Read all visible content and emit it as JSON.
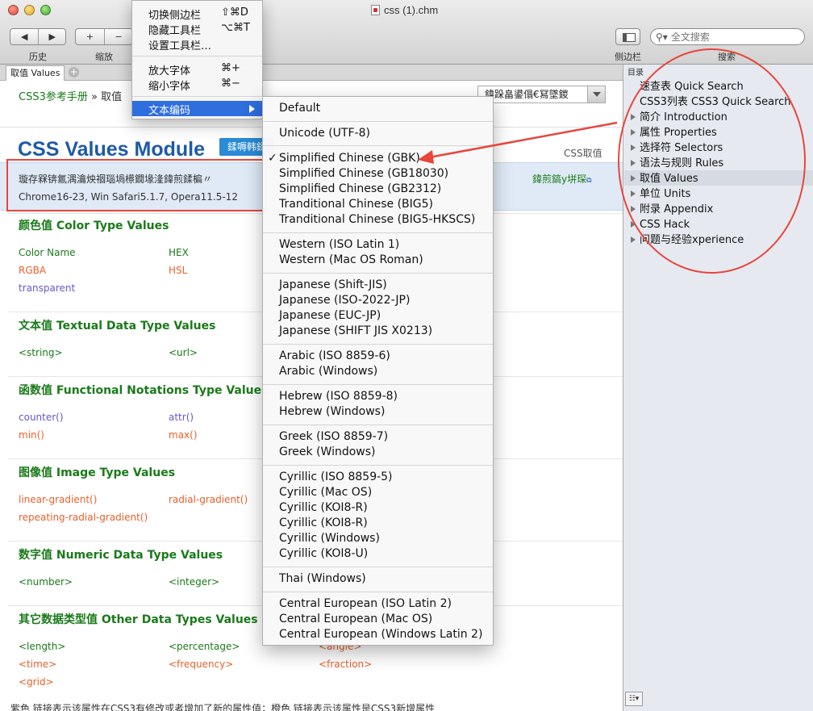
{
  "window": {
    "title": "css (1).chm"
  },
  "toolbar": {
    "history_label": "历史",
    "zoom_label": "缩放",
    "sidebar_label": "侧边栏",
    "search_label": "搜索",
    "search_placeholder": "全文搜索",
    "back": "◀",
    "forward": "▶",
    "zoom_in": "+",
    "zoom_out": "−"
  },
  "tabs": [
    {
      "label": "取值 Values"
    }
  ],
  "view_menu": {
    "items": [
      {
        "label": "切换侧边栏",
        "shortcut": "⇧⌘D"
      },
      {
        "label": "隐藏工具栏",
        "shortcut": "⌥⌘T"
      },
      {
        "label": "设置工具栏…",
        "shortcut": ""
      },
      {
        "label": "放大字体",
        "shortcut": "⌘+"
      },
      {
        "label": "缩小字体",
        "shortcut": "⌘−"
      },
      {
        "label": "文本编码",
        "shortcut": ""
      }
    ]
  },
  "encoding_menu": {
    "selected": "Simplified Chinese (GBK)",
    "items": [
      "Default",
      "Unicode (UTF-8)",
      "Simplified Chinese (GBK)",
      "Simplified Chinese (GB18030)",
      "Simplified Chinese (GB2312)",
      "Tranditional Chinese (BIG5)",
      "Tranditional Chinese (BIG5-HKSCS)",
      "Western (ISO Latin 1)",
      "Western (Mac OS Roman)",
      "Japanese (Shift-JIS)",
      "Japanese (ISO-2022-JP)",
      "Japanese (EUC-JP)",
      "Japanese (SHIFT JIS X0213)",
      "Arabic (ISO 8859-6)",
      "Arabic (Windows)",
      "Hebrew (ISO 8859-8)",
      "Hebrew (Windows)",
      "Greek (ISO 8859-7)",
      "Greek (Windows)",
      "Cyrillic (ISO 8859-5)",
      "Cyrillic (Mac OS)",
      "Cyrillic (KOI8-R)",
      "Cyrillic (KOI8-R)",
      "Cyrillic (Windows)",
      "Cyrillic (KOI8-U)",
      "Thai (Windows)",
      "Central European (ISO Latin 2)",
      "Central European (Mac OS)",
      "Central European (Windows Latin 2)"
    ]
  },
  "content": {
    "breadcrumb_home": "CSS3参考手册",
    "breadcrumb_sep": "»",
    "breadcrumb_current": "取值",
    "header_select": "鍏跺畠鍙傝€冩墜鍐",
    "page_title": "CSS Values Module",
    "title_badge": "鍒嗕韩鍒",
    "title_right": "CSS取值",
    "compat_line1": "璇存槑锛氱湡瀹炴祻瑙堝櫒鐗堟湰鍏煎鍒楄〃",
    "compat_line2": "Chrome16-23, Win Safari5.1.7, Opera11.5-12",
    "compat_link": "鍏煎鎬у垪琛",
    "footer_note": "紫色 链接表示该属性在CSS3有修改或者增加了新的属性值；橙色 链接表示该属性是CSS3新增属性"
  },
  "sections": [
    {
      "title": "颜色值 Color Type Values",
      "values": [
        {
          "text": "Color Name",
          "color": "green"
        },
        {
          "text": "HEX",
          "color": "green"
        },
        {
          "text": "RGBA",
          "color": "orange"
        },
        {
          "text": "HSL",
          "color": "orange"
        },
        {
          "text": "transparent",
          "color": "purple"
        }
      ]
    },
    {
      "title": "文本值 Textual Data Type Values",
      "values": [
        {
          "text": "<string>",
          "color": "green"
        },
        {
          "text": "<url>",
          "color": "green"
        }
      ]
    },
    {
      "title": "函数值 Functional Notations Type Values",
      "values": [
        {
          "text": "counter()",
          "color": "purple"
        },
        {
          "text": "attr()",
          "color": "purple"
        },
        {
          "text": "min()",
          "color": "orange"
        },
        {
          "text": "max()",
          "color": "orange"
        }
      ]
    },
    {
      "title": "图像值 Image Type Values",
      "values": [
        {
          "text": "linear-gradient()",
          "color": "orange"
        },
        {
          "text": "radial-gradient()",
          "color": "orange"
        },
        {
          "text": "repeating-radial-gradient()",
          "color": "orange"
        }
      ]
    },
    {
      "title": "数字值 Numeric Data Type Values",
      "values": [
        {
          "text": "<number>",
          "color": "green"
        },
        {
          "text": "<integer>",
          "color": "green"
        }
      ]
    },
    {
      "title": "其它数据类型值 Other Data Types Values",
      "values": [
        {
          "text": "<length>",
          "color": "green"
        },
        {
          "text": "<percentage>",
          "color": "green"
        },
        {
          "text": "<angle>",
          "color": "orange"
        },
        {
          "text": "<time>",
          "color": "orange"
        },
        {
          "text": "<frequency>",
          "color": "orange"
        },
        {
          "text": "<fraction>",
          "color": "orange"
        },
        {
          "text": "<grid>",
          "color": "orange"
        }
      ]
    }
  ],
  "sidebar": {
    "heading": "目录",
    "items": [
      {
        "label": "速查表 Quick Search",
        "expandable": false
      },
      {
        "label": "CSS3列表 CSS3 Quick Search",
        "expandable": false
      },
      {
        "label": "简介 Introduction",
        "expandable": true
      },
      {
        "label": "属性 Properties",
        "expandable": true
      },
      {
        "label": "选择符 Selectors",
        "expandable": true
      },
      {
        "label": "语法与规则 Rules",
        "expandable": true
      },
      {
        "label": "取值 Values",
        "expandable": true,
        "selected": true
      },
      {
        "label": "单位 Units",
        "expandable": true
      },
      {
        "label": "附录 Appendix",
        "expandable": true
      },
      {
        "label": "CSS Hack",
        "expandable": true
      },
      {
        "label": "问题与经验xperience",
        "expandable": true
      }
    ],
    "footer_button": "☷▾"
  },
  "colors": {
    "accent": "#2e6edf",
    "annotation_red": "#e8453c",
    "link_green": "#1a7a1a",
    "css3_new_orange": "#e8602a",
    "css3_modified_purple": "#6a56c8",
    "title_blue": "#1e5aa8"
  }
}
